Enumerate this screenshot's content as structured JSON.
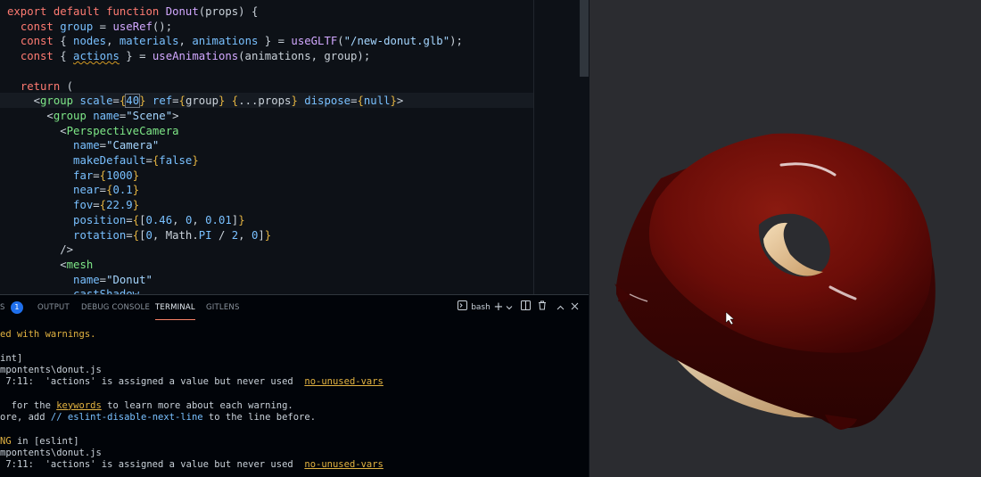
{
  "editor": {
    "lines": [
      {
        "parts": [
          [
            "k",
            "export "
          ],
          [
            "k",
            "default "
          ],
          [
            "k",
            "function "
          ],
          [
            "f",
            "Donut"
          ],
          [
            "p",
            "(props) {"
          ]
        ]
      },
      {
        "parts": [
          [
            "p",
            "  "
          ],
          [
            "k",
            "const "
          ],
          [
            "v",
            "group"
          ],
          [
            "p",
            " = "
          ],
          [
            "f",
            "useRef"
          ],
          [
            "p",
            "();"
          ]
        ]
      },
      {
        "parts": [
          [
            "p",
            "  "
          ],
          [
            "k",
            "const "
          ],
          [
            "p",
            "{ "
          ],
          [
            "v",
            "nodes"
          ],
          [
            "p",
            ", "
          ],
          [
            "v",
            "materials"
          ],
          [
            "p",
            ", "
          ],
          [
            "v",
            "animations"
          ],
          [
            "p",
            " } = "
          ],
          [
            "f",
            "useGLTF"
          ],
          [
            "p",
            "("
          ],
          [
            "s",
            "\"/new-donut.glb\""
          ],
          [
            "p",
            ");"
          ]
        ]
      },
      {
        "parts": [
          [
            "p",
            "  "
          ],
          [
            "k",
            "const "
          ],
          [
            "p",
            "{ "
          ],
          [
            "squiggle",
            "actions"
          ],
          [
            "p",
            " } = "
          ],
          [
            "f",
            "useAnimations"
          ],
          [
            "p",
            "(animations, group);"
          ]
        ]
      },
      {
        "parts": []
      },
      {
        "parts": [
          [
            "p",
            "  "
          ],
          [
            "k",
            "return "
          ],
          [
            "p",
            "("
          ]
        ]
      },
      {
        "parts": [
          [
            "p",
            "    <"
          ],
          [
            "t",
            "group "
          ],
          [
            "a",
            "scale"
          ],
          [
            "p",
            "="
          ],
          [
            "g",
            "{"
          ],
          [
            "box",
            "40"
          ],
          [
            "g",
            "}"
          ],
          [
            "p",
            " "
          ],
          [
            "a",
            "ref"
          ],
          [
            "p",
            "="
          ],
          [
            "g",
            "{"
          ],
          [
            "p",
            "group"
          ],
          [
            "g",
            "}"
          ],
          [
            "p",
            " "
          ],
          [
            "g",
            "{"
          ],
          [
            "p",
            "...props"
          ],
          [
            "g",
            "}"
          ],
          [
            "p",
            " "
          ],
          [
            "a",
            "dispose"
          ],
          [
            "p",
            "="
          ],
          [
            "g",
            "{"
          ],
          [
            "v",
            "null"
          ],
          [
            "g",
            "}"
          ],
          [
            "p",
            ">"
          ]
        ]
      },
      {
        "parts": [
          [
            "p",
            "      <"
          ],
          [
            "t",
            "group "
          ],
          [
            "a",
            "name"
          ],
          [
            "p",
            "="
          ],
          [
            "s",
            "\"Scene\""
          ],
          [
            "p",
            ">"
          ]
        ]
      },
      {
        "parts": [
          [
            "p",
            "        <"
          ],
          [
            "t",
            "PerspectiveCamera"
          ]
        ]
      },
      {
        "parts": [
          [
            "p",
            "          "
          ],
          [
            "a",
            "name"
          ],
          [
            "p",
            "="
          ],
          [
            "s",
            "\"Camera\""
          ]
        ]
      },
      {
        "parts": [
          [
            "p",
            "          "
          ],
          [
            "a",
            "makeDefault"
          ],
          [
            "p",
            "="
          ],
          [
            "g",
            "{"
          ],
          [
            "v",
            "false"
          ],
          [
            "g",
            "}"
          ]
        ]
      },
      {
        "parts": [
          [
            "p",
            "          "
          ],
          [
            "a",
            "far"
          ],
          [
            "p",
            "="
          ],
          [
            "g",
            "{"
          ],
          [
            "v",
            "1000"
          ],
          [
            "g",
            "}"
          ]
        ]
      },
      {
        "parts": [
          [
            "p",
            "          "
          ],
          [
            "a",
            "near"
          ],
          [
            "p",
            "="
          ],
          [
            "g",
            "{"
          ],
          [
            "v",
            "0.1"
          ],
          [
            "g",
            "}"
          ]
        ]
      },
      {
        "parts": [
          [
            "p",
            "          "
          ],
          [
            "a",
            "fov"
          ],
          [
            "p",
            "="
          ],
          [
            "g",
            "{"
          ],
          [
            "v",
            "22.9"
          ],
          [
            "g",
            "}"
          ]
        ]
      },
      {
        "parts": [
          [
            "p",
            "          "
          ],
          [
            "a",
            "position"
          ],
          [
            "p",
            "="
          ],
          [
            "g",
            "{"
          ],
          [
            "p",
            "["
          ],
          [
            "v",
            "0.46"
          ],
          [
            "p",
            ", "
          ],
          [
            "v",
            "0"
          ],
          [
            "p",
            ", "
          ],
          [
            "v",
            "0.01"
          ],
          [
            "p",
            "]"
          ],
          [
            "g",
            "}"
          ]
        ]
      },
      {
        "parts": [
          [
            "p",
            "          "
          ],
          [
            "a",
            "rotation"
          ],
          [
            "p",
            "="
          ],
          [
            "g",
            "{"
          ],
          [
            "p",
            "["
          ],
          [
            "v",
            "0"
          ],
          [
            "p",
            ", Math."
          ],
          [
            "v",
            "PI"
          ],
          [
            "p",
            " / "
          ],
          [
            "v",
            "2"
          ],
          [
            "p",
            ", "
          ],
          [
            "v",
            "0"
          ],
          [
            "p",
            "]"
          ],
          [
            "g",
            "}"
          ]
        ]
      },
      {
        "parts": [
          [
            "p",
            "        />"
          ]
        ]
      },
      {
        "parts": [
          [
            "p",
            "        <"
          ],
          [
            "t",
            "mesh"
          ]
        ]
      },
      {
        "parts": [
          [
            "p",
            "          "
          ],
          [
            "a",
            "name"
          ],
          [
            "p",
            "="
          ],
          [
            "s",
            "\"Donut\""
          ]
        ]
      },
      {
        "parts": [
          [
            "p",
            "          "
          ],
          [
            "a",
            "castShadow"
          ]
        ]
      }
    ]
  },
  "panel": {
    "tabs": [
      {
        "label": "S",
        "name": "tab-problems"
      },
      {
        "label": "OUTPUT",
        "name": "tab-output"
      },
      {
        "label": "DEBUG CONSOLE",
        "name": "tab-debug-console"
      },
      {
        "label": "TERMINAL",
        "name": "tab-terminal",
        "active": true
      },
      {
        "label": "GITLENS",
        "name": "tab-gitlens"
      }
    ],
    "problems_count": "1",
    "shell_label": "bash",
    "icons": [
      "terminal-icon",
      "add-terminal-icon",
      "chevron-down-icon",
      "split-terminal-icon",
      "trash-icon",
      "maximize-panel-icon",
      "close-panel-icon"
    ],
    "terminal_lines": [
      [
        [
          "warn",
          "ed with warnings."
        ]
      ],
      [
        [
          "p",
          ""
        ]
      ],
      [
        [
          "p",
          "int]"
        ]
      ],
      [
        [
          "p",
          "mpontents\\donut.js"
        ]
      ],
      [
        [
          "p",
          " 7:11:  'actions' is assigned a value but never used  "
        ],
        [
          "link",
          "no-unused-vars"
        ]
      ],
      [
        [
          "p",
          ""
        ]
      ],
      [
        [
          "p",
          "  for the "
        ],
        [
          "link",
          "keywords"
        ],
        [
          "p",
          " to learn more about each warning."
        ]
      ],
      [
        [
          "p",
          "ore, add "
        ],
        [
          "cmt",
          "// eslint-disable-next-line"
        ],
        [
          "p",
          " to the line before."
        ]
      ],
      [
        [
          "p",
          ""
        ]
      ],
      [
        [
          "warn",
          "NG"
        ],
        [
          "p",
          " in [eslint]"
        ]
      ],
      [
        [
          "p",
          "mpontents\\donut.js"
        ]
      ],
      [
        [
          "p",
          " 7:11:  'actions' is assigned a value but never used  "
        ],
        [
          "link",
          "no-unused-vars"
        ]
      ]
    ]
  },
  "viewport": {
    "background": "#2b2c30",
    "donut_color": "#6b0d08",
    "cream_color": "#e7c79a"
  }
}
